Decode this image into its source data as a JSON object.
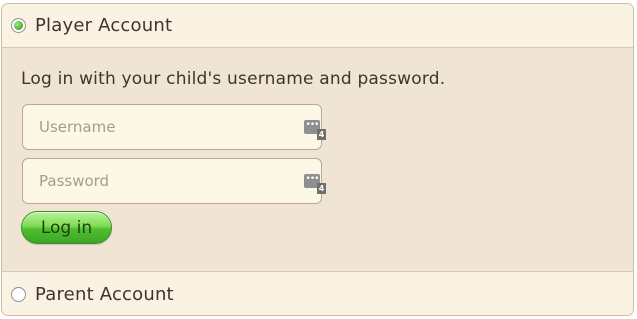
{
  "player_account": {
    "label": "Player Account",
    "selected": true,
    "instructions": "Log in with your child's username and password.",
    "username": {
      "value": "",
      "placeholder": "Username"
    },
    "password": {
      "value": "",
      "placeholder": "Password"
    },
    "password_manager_badge": "4",
    "login_label": "Log in"
  },
  "parent_account": {
    "label": "Parent Account",
    "selected": false
  },
  "colors": {
    "panel_bg": "#f0e5d4",
    "header_bg": "#faf2e2",
    "field_bg": "#fcf7e6",
    "button_green": "#4fbf2f",
    "radio_selected": "#4fb83a"
  },
  "icons": {
    "field_icon": "password-manager-icon"
  }
}
